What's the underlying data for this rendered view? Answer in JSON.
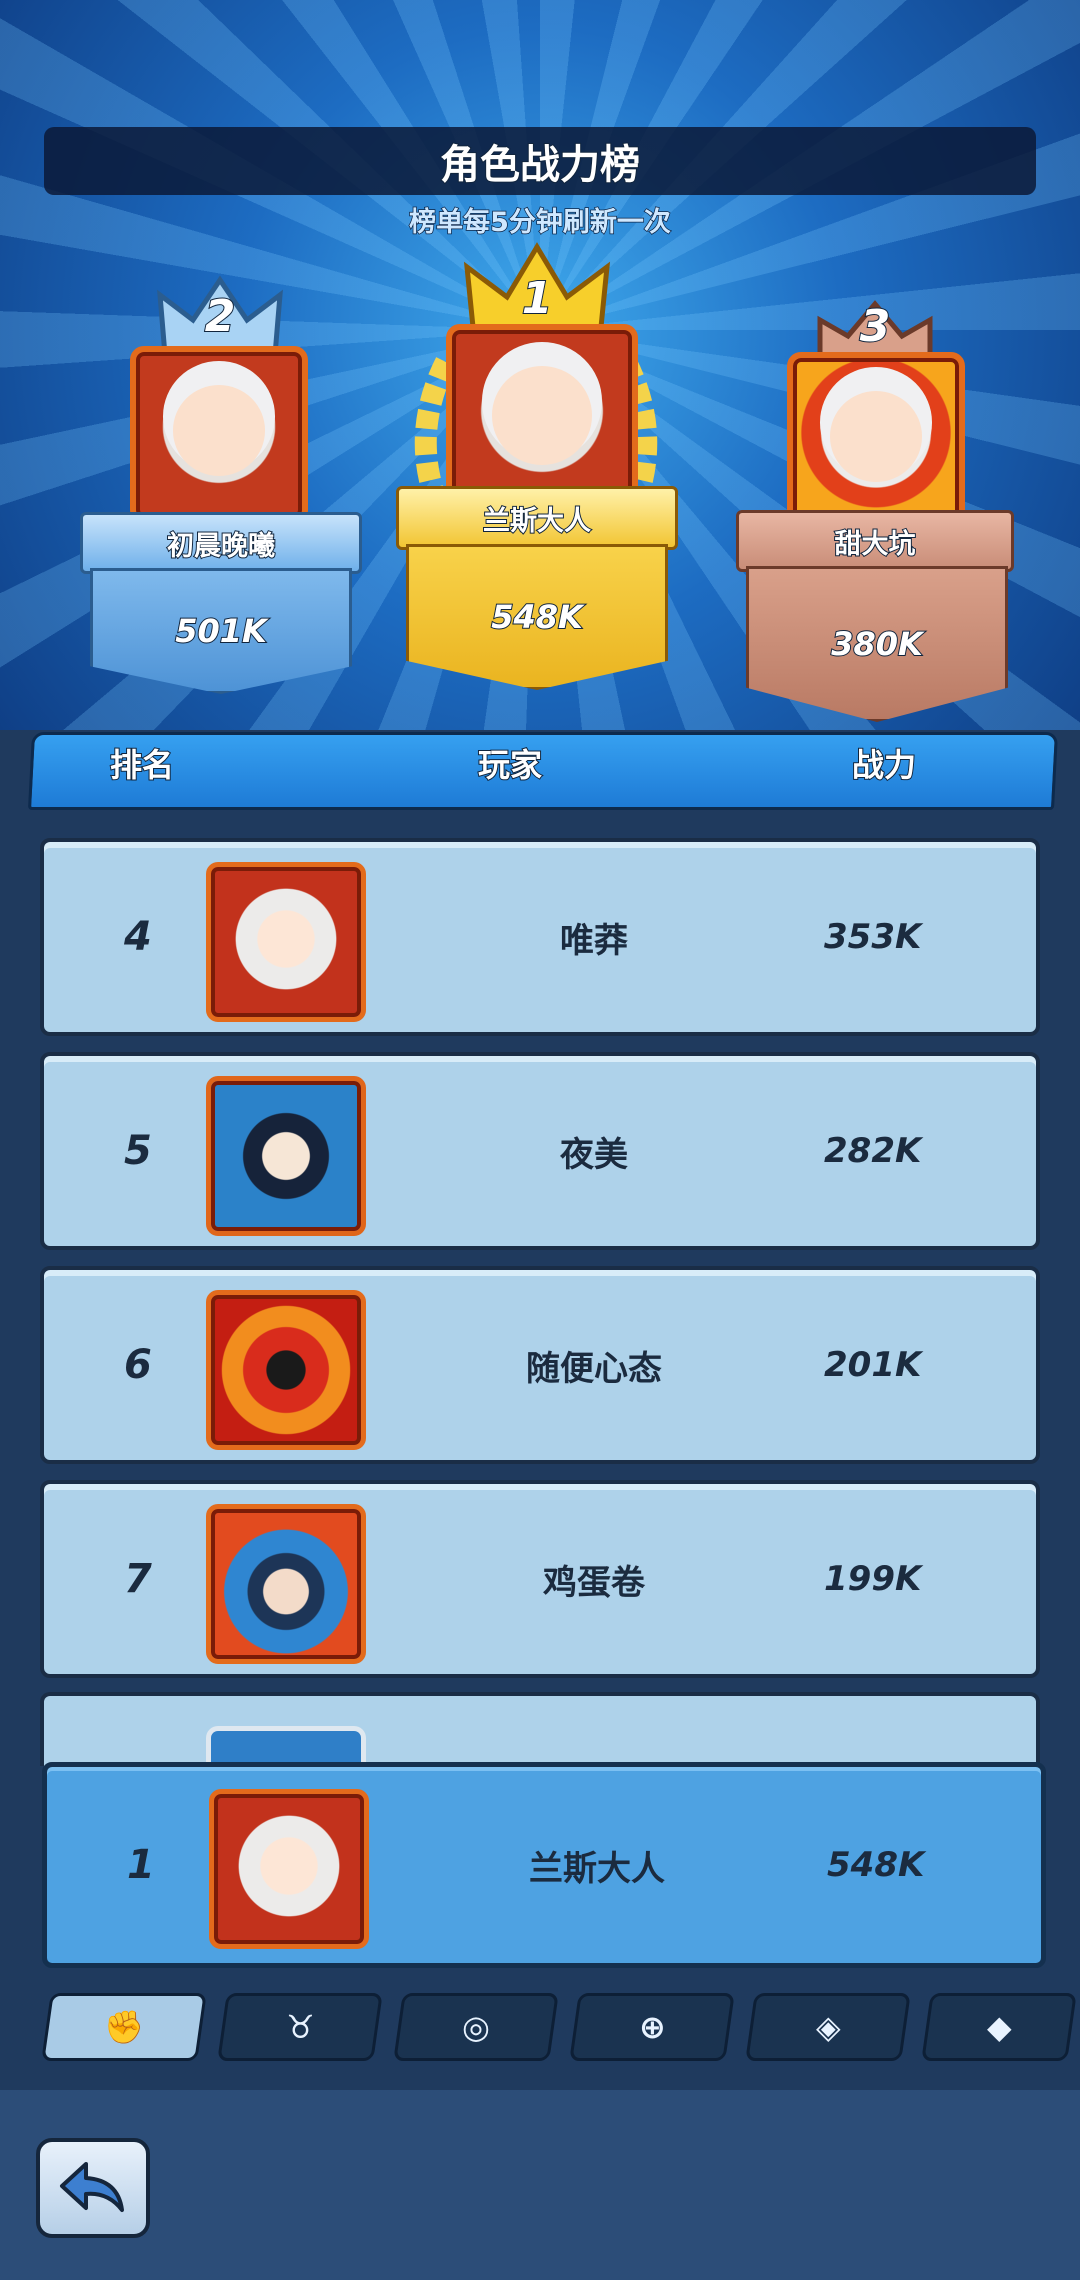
{
  "header": {
    "title": "角色战力榜",
    "subtitle": "榜单每5分钟刷新一次"
  },
  "podium": {
    "first": {
      "rank": "1",
      "name": "兰斯大人",
      "power": "548K"
    },
    "second": {
      "rank": "2",
      "name": "初晨晚曦",
      "power": "501K"
    },
    "third": {
      "rank": "3",
      "name": "甜大坑",
      "power": "380K"
    }
  },
  "list": {
    "headers": {
      "rank": "排名",
      "player": "玩家",
      "power": "战力"
    },
    "rows": [
      {
        "rank": "4",
        "name": "唯莽",
        "power": "353K",
        "avatar": "white-hair-girl"
      },
      {
        "rank": "5",
        "name": "夜美",
        "power": "282K",
        "avatar": "dark-hair-boy"
      },
      {
        "rank": "6",
        "name": "随便心态",
        "power": "201K",
        "avatar": "red-dragon"
      },
      {
        "rank": "7",
        "name": "鸡蛋卷",
        "power": "199K",
        "avatar": "blue-hair-demon"
      }
    ]
  },
  "my_rank": {
    "rank": "1",
    "name": "兰斯大人",
    "power": "548K"
  },
  "tabs": [
    {
      "icon": "fist-icon",
      "active": true
    },
    {
      "icon": "bull-horns-icon",
      "active": false
    },
    {
      "icon": "swirl-card-icon",
      "active": false
    },
    {
      "icon": "target-card-icon",
      "active": false
    },
    {
      "icon": "cards-fan-icon",
      "active": false
    },
    {
      "icon": "gem-card-icon",
      "active": false
    }
  ],
  "colors": {
    "gold": "#f5c431",
    "silver_blue": "#7fb9ec",
    "bronze": "#c98d78",
    "row_bg": "#aed2ea",
    "my_row_bg": "#4ea2e2"
  }
}
